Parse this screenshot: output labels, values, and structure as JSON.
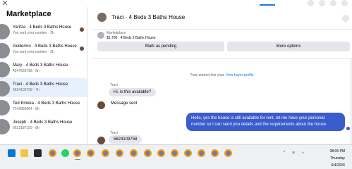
{
  "sidebar": {
    "title": "Marketplace",
    "items": [
      {
        "name": "Yaritza · 4 Beds 3 Baths House",
        "sub": "You sent your number · 2h"
      },
      {
        "name": "Guillermo · 4 Beds 3 Baths House",
        "sub": "You sent your number · 2h"
      },
      {
        "name": "Mary · 4 Beds 3 Baths House",
        "sub": "4247665758 · 5h"
      },
      {
        "name": "Traci · 4 Beds 3 Baths House",
        "sub": "5624109758 · 7h"
      },
      {
        "name": "Ted Emeka · 4 Beds 3 Baths House",
        "sub": "7143950004 · 8h"
      },
      {
        "name": "Joseph · 4 Beds 3 Baths House",
        "sub": "6612187159 · 8h"
      }
    ]
  },
  "header": {
    "title": "Traci · 4 Beds 3 Baths House"
  },
  "listing": {
    "label": "Marketplace",
    "price_title": "$1,700 · 4 Beds 3 Baths House",
    "pending_label": "Mark as pending",
    "more_label": "More options"
  },
  "chat": {
    "system_text": "Traci started this chat.",
    "system_link": "View buyer profile",
    "sender1": "Traci",
    "msg1": "Hi, is this available?",
    "msg2": "Message sent",
    "msg_me": "Hello, yes the house is still available for rent, let me have your personal number so I can send you details and the requirements about the house",
    "sender2": "Traci",
    "msg3": "5624109758"
  },
  "taskbar": {
    "time": "08:06 PM",
    "day": "Thursday",
    "date": "6/4/2026"
  }
}
